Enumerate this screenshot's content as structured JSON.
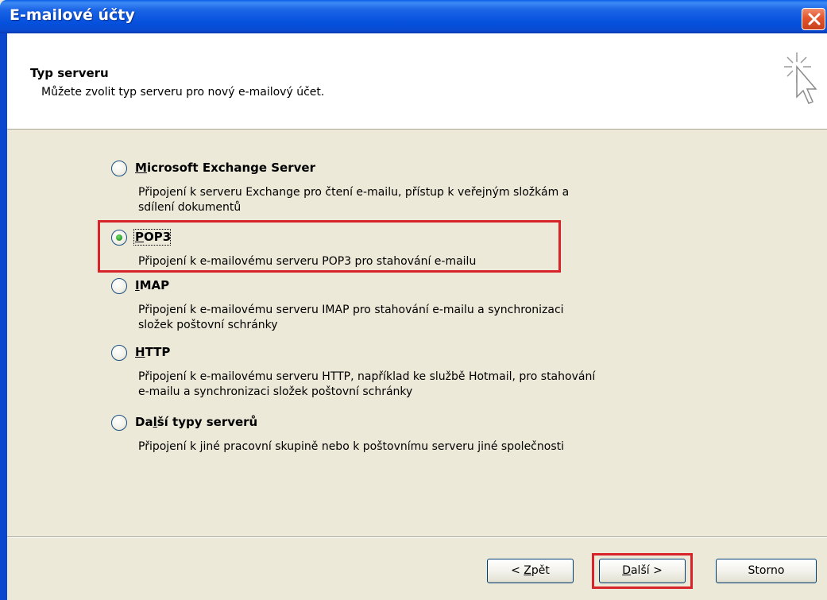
{
  "window": {
    "title": "E-mailové účty"
  },
  "header": {
    "title": "Typ serveru",
    "subtitle": "Můžete zvolit typ serveru pro nový e-mailový účet."
  },
  "options": [
    {
      "label_accel": "M",
      "label_rest": "icrosoft Exchange Server",
      "selected": false,
      "desc_line1": "Připojení k serveru Exchange pro čtení e-mailu, přístup k veřejným složkám a",
      "desc_line2": "sdílení dokumentů"
    },
    {
      "label_accel": "P",
      "label_rest": "OP3",
      "selected": true,
      "desc_line1": "Připojení k e-mailovému serveru POP3 pro stahování e-mailu",
      "desc_line2": ""
    },
    {
      "label_accel": "I",
      "label_rest": "MAP",
      "selected": false,
      "desc_line1": "Připojení k e-mailovému serveru IMAP pro stahování e-mailu a synchronizaci",
      "desc_line2": "složek poštovní schránky"
    },
    {
      "label_accel": "H",
      "label_rest": "TTP",
      "selected": false,
      "desc_line1": "Připojení k e-mailovému serveru HTTP, například ke službě Hotmail, pro stahování",
      "desc_line2": "e-mailu a synchronizaci složek poštovní schránky"
    },
    {
      "label_pre": "Da",
      "label_accel": "l",
      "label_rest": "ší typy serverů",
      "selected": false,
      "desc_line1": "Připojení k jiné pracovní skupině nebo k poštovnímu serveru jiné společnosti",
      "desc_line2": ""
    }
  ],
  "buttons": {
    "back_pre": "< ",
    "back_accel": "Z",
    "back_rest": "pět",
    "next_accel": "D",
    "next_rest": "alší >",
    "cancel": "Storno"
  },
  "colors": {
    "titlebar": "#0a5ee6",
    "highlight": "#d8232a",
    "dialog_bg": "#ece9d8"
  }
}
